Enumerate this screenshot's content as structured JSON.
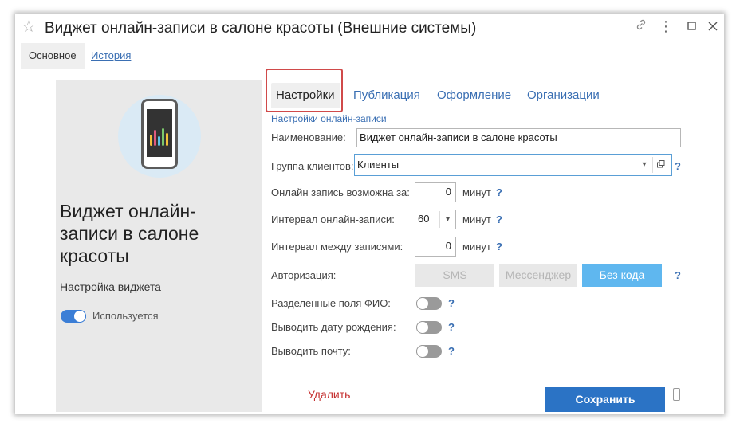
{
  "window": {
    "title": "Виджет онлайн-записи в салоне красоты (Внешние системы)"
  },
  "nav": {
    "main": "Основное",
    "history": "История"
  },
  "left": {
    "title": "Виджет онлайн-записи в салоне красоты",
    "setup": "Настройка виджета",
    "toggle_label": "Используется",
    "toggle_on": true
  },
  "tabs": [
    "Настройки",
    "Публикация",
    "Оформление",
    "Организации"
  ],
  "form": {
    "section": "Настройки онлайн-записи",
    "name_label": "Наименование:",
    "name_value": "Виджет онлайн-записи в салоне красоты",
    "group_label": "Группа клиентов:",
    "group_value": "Клиенты",
    "online_label": "Онлайн запись возможна за:",
    "online_value": "0",
    "interval_label": "Интервал онлайн-записи:",
    "interval_value": "60",
    "between_label": "Интервал между записями:",
    "between_value": "0",
    "unit": "минут",
    "auth_label": "Авторизация:",
    "auth_options": [
      "SMS",
      "Мессенджер",
      "Без кода"
    ],
    "auth_selected": "Без кода",
    "fio_label": "Разделенные поля ФИО:",
    "birth_label": "Выводить дату рождения:",
    "mail_label": "Выводить почту:",
    "help": "?"
  },
  "buttons": {
    "delete": "Удалить",
    "save": "Сохранить"
  },
  "colors": {
    "accent": "#2b73c5",
    "selected_segment": "#5fb7ef",
    "link": "#3a6fb3",
    "delete": "#c53030"
  }
}
